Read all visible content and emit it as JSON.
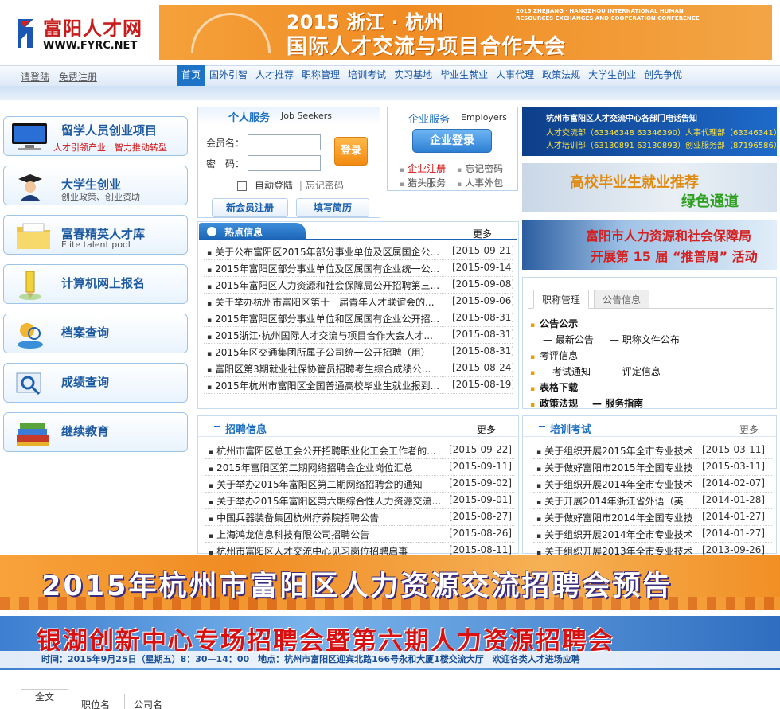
{
  "header": {
    "logo_cn": "富阳人才网",
    "logo_en": "WWW.FYRC.NET",
    "banner_line1": "2015 浙江 · 杭州",
    "banner_line2": "国际人才交流与项目合作大会",
    "banner_en": "2015 ZHEJIANG · HANGZHOU INTERNATIONAL HUMAN RESOURCES EXCHANGES AND COOPERATION CONFERENCE"
  },
  "nav": {
    "login": "请登陆",
    "register": "免费注册",
    "items": [
      "首页",
      "国外引智",
      "人才推荐",
      "职称管理",
      "培训考试",
      "实习基地",
      "毕业生就业",
      "人事代理",
      "政策法规",
      "大学生创业",
      "创先争优"
    ]
  },
  "left_menu": [
    {
      "title": "留学人员创业项目",
      "sub": "人才引领产业　智力推动转型"
    },
    {
      "title": "大学生创业",
      "sub": "创业政策、创业资助"
    },
    {
      "title": "富春精英人才库",
      "sub": "Elite talent pool"
    },
    {
      "title": "计算机网上报名",
      "sub": ""
    },
    {
      "title": "档案查询",
      "sub": ""
    },
    {
      "title": "成绩查询",
      "sub": ""
    },
    {
      "title": "继续教育",
      "sub": ""
    }
  ],
  "personal": {
    "title_cn": "个人服务",
    "title_en": "Job Seekers",
    "member_label": "会员名：",
    "password_label": "密　码：",
    "login": "登录",
    "auto_login": "自动登陆",
    "forgot": "忘记密码",
    "new_member": "新会员注册",
    "fill_resume": "填写简历"
  },
  "enterprise": {
    "title_cn": "企业服务",
    "title_en": "Employers",
    "login": "企业登录",
    "links": [
      "企业注册",
      "忘记密码",
      "猎头服务",
      "人事外包"
    ]
  },
  "hot": {
    "title": "热点信息",
    "more": "更多",
    "items": [
      {
        "t": "关于公布富阳区2015年部分事业单位及区属国企公...",
        "d": "[2015-09-21]"
      },
      {
        "t": "2015年富阳区部分事业单位及区属国有企业统一公...",
        "d": "[2015-09-14]"
      },
      {
        "t": "2015年富阳区人力资源和社会保障局公开招聘第三...",
        "d": "[2015-09-08]"
      },
      {
        "t": "关于举办杭州市富阳区第十一届青年人才联谊会的...",
        "d": "[2015-09-06]"
      },
      {
        "t": "2015年富阳区部分事业单位和区属国有企业公开招...",
        "d": "[2015-08-31]"
      },
      {
        "t": "2015浙江·杭州国际人才交流与项目合作大会人才...",
        "d": "[2015-08-31]"
      },
      {
        "t": "2015年区交通集团所属子公司统一公开招聘（用）",
        "d": "[2015-08-31]"
      },
      {
        "t": "富阳区第3期就业社保协管员招聘考生综合成绩公...",
        "d": "[2015-08-24]"
      },
      {
        "t": "2015年杭州市富阳区全国普通高校毕业生就业报到...",
        "d": "[2015-08-19]"
      }
    ]
  },
  "right_ads": {
    "ad1_title": "杭州市富阳区人才交流中心各部门电话告知",
    "ad1_line1": "人才交流部（63346348 63346390）人事代理部（63346341）",
    "ad1_line2": "人才培训部（63130891 63130893）创业服务部（87196586）",
    "ad2_line1": "高校毕业生就业推荐",
    "ad2_line2": "绿色通道",
    "ad3_line1": "富阳市人力资源和社会保障局",
    "ad3_line2": "开展第 15 届 “推普周” 活动"
  },
  "tabbox": {
    "tabs": [
      "职称管理",
      "公告信息"
    ],
    "notice": "公告公示",
    "latest": "最新公告",
    "title_doc": "职称文件公布",
    "exam": "考评信息",
    "exam_notice": "考试通知",
    "eval_info": "评定信息",
    "forms": "表格下载",
    "policy": "政策法规",
    "guide": "服务指南"
  },
  "recruit": {
    "title": "招聘信息",
    "more": "更多",
    "items": [
      {
        "t": "杭州市富阳区总工会公开招聘职业化工会工作者的...",
        "d": "[2015-09-22]"
      },
      {
        "t": "2015年富阳区第二期网络招聘会企业岗位汇总",
        "d": "[2015-09-11]"
      },
      {
        "t": "关于举办2015年富阳区第二期网络招聘会的通知",
        "d": "[2015-09-02]"
      },
      {
        "t": "关于举办2015年富阳区第六期综合性人力资源交流...",
        "d": "[2015-09-01]"
      },
      {
        "t": "中国兵器装备集团杭州疗养院招聘公告",
        "d": "[2015-08-27]"
      },
      {
        "t": "上海鸿龙信息科技有限公司招聘公告",
        "d": "[2015-08-26]"
      },
      {
        "t": "杭州市富阳区人才交流中心见习岗位招聘启事",
        "d": "[2015-08-11]"
      }
    ]
  },
  "training": {
    "title": "培训考试",
    "more": "更多",
    "items": [
      {
        "t": "关于组织开展2015年全市专业技术",
        "d": "[2015-03-11]"
      },
      {
        "t": "关于做好富阳市2015年全国专业技",
        "d": "[2015-03-11]"
      },
      {
        "t": "关于组织开展2014年全市专业技术",
        "d": "[2014-02-07]"
      },
      {
        "t": "关于开展2014年浙江省外语（英",
        "d": "[2014-01-28]"
      },
      {
        "t": "关于做好富阳市2014年全国专业技",
        "d": "[2014-01-27]"
      },
      {
        "t": "关于组织开展2014年全市专业技术",
        "d": "[2014-01-27]"
      },
      {
        "t": "关于组织开展2013年全市专业技术",
        "d": "[2013-09-26]"
      }
    ]
  },
  "banners": {
    "b1": "2015年杭州市富阳区人力资源交流招聘会预告",
    "b2": "银湖创新中心专场招聘会暨第六期人力资源招聘会",
    "b2_info": "时间：2015年9月25日（星期五）8：30—14：00　地点：杭州市富阳区迎宾北路166号永和大厦1楼交流大厅　欢迎各类人才进场应聘"
  },
  "search_tabs": [
    "全文",
    "职位名",
    "公司名"
  ]
}
